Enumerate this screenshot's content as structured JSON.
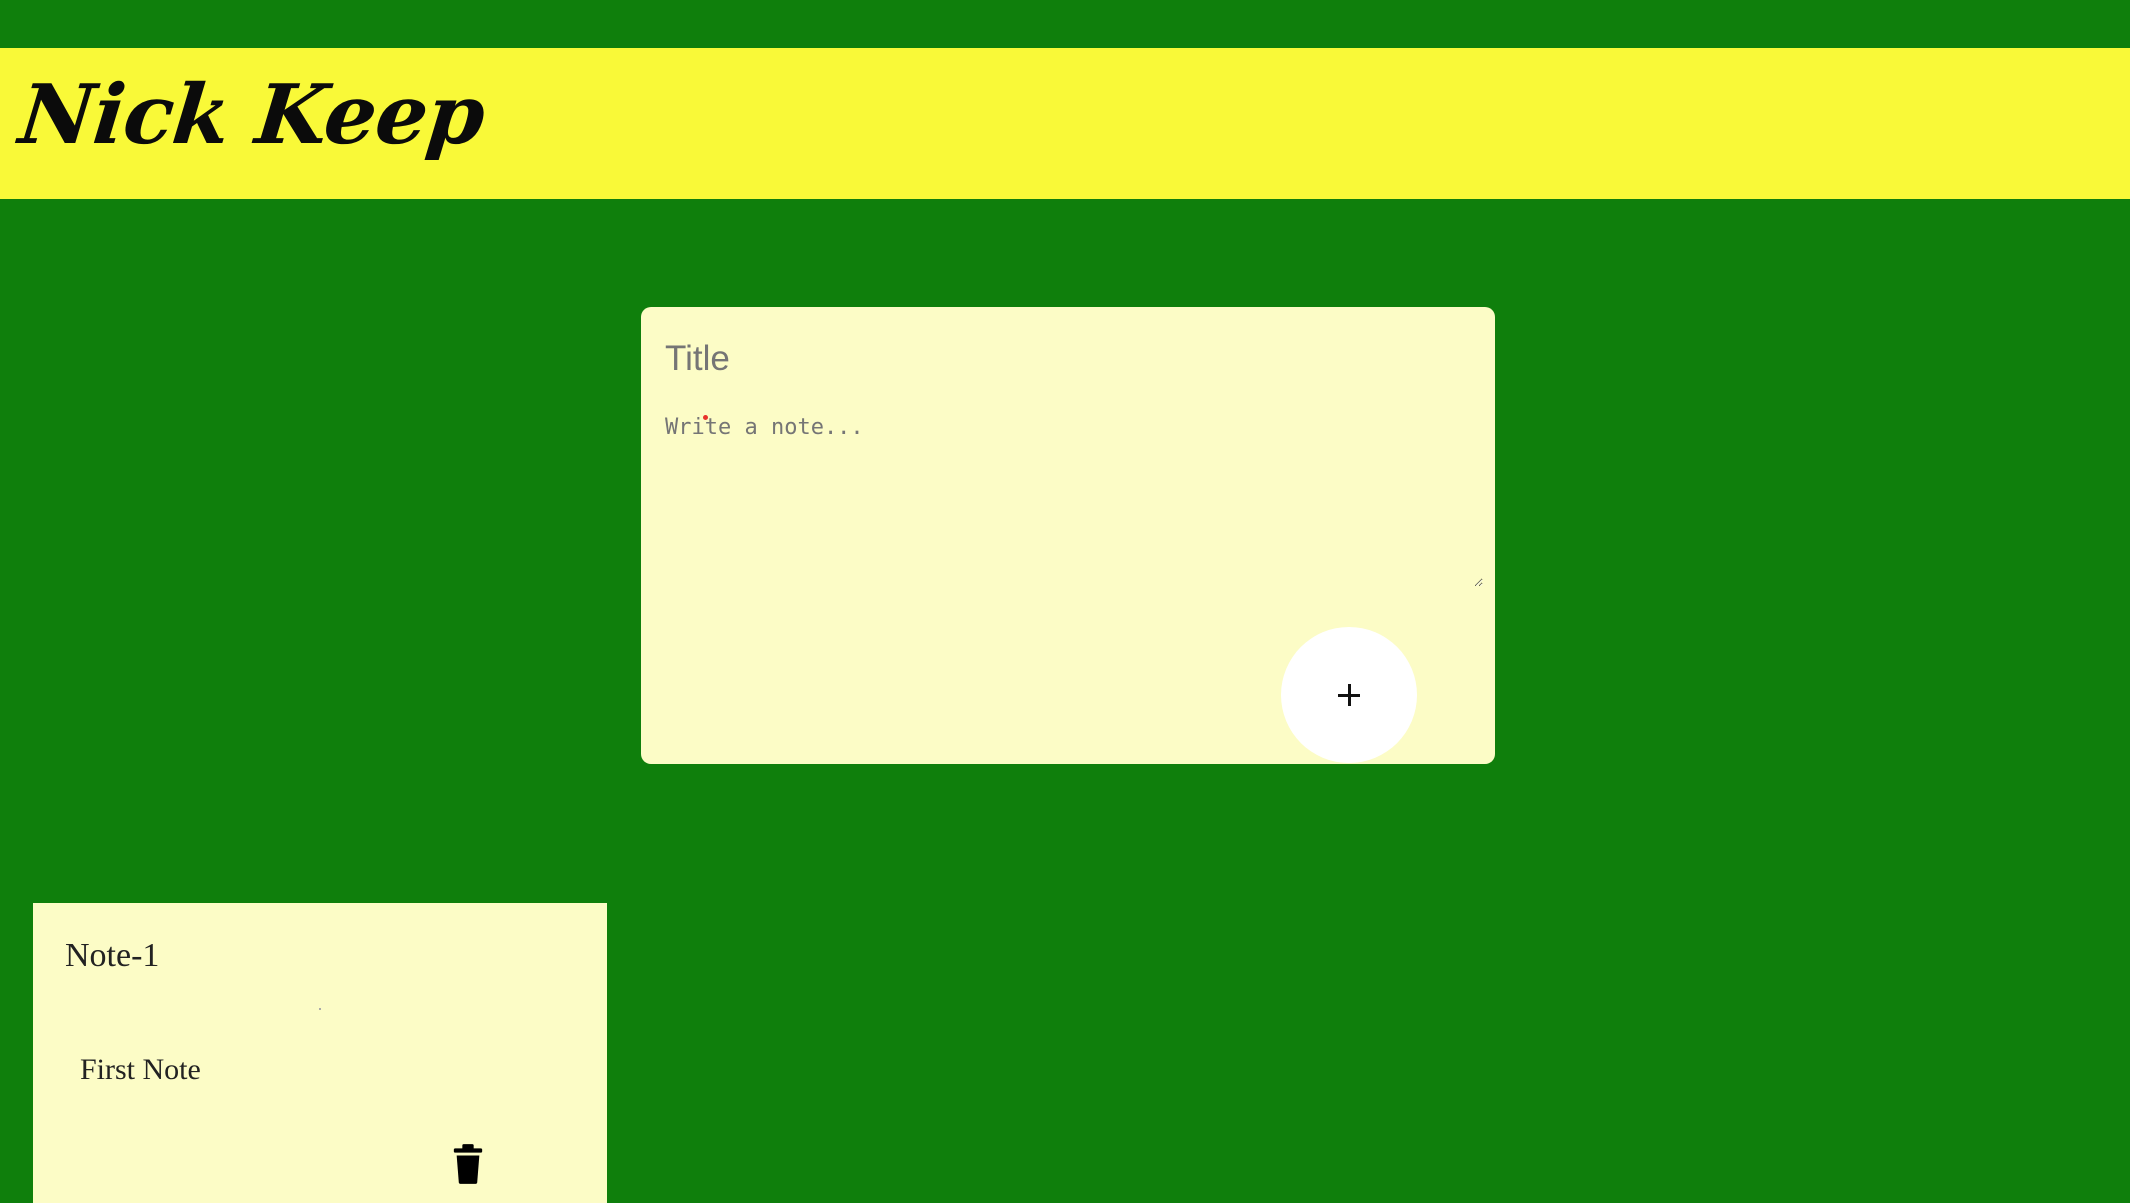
{
  "header": {
    "logo_text": "Nick Keep"
  },
  "composer": {
    "title_placeholder": "Title",
    "title_value": "",
    "note_placeholder": "Write a note...",
    "note_value": "",
    "add_button_icon": "plus-icon"
  },
  "notes": [
    {
      "title": "Note-1",
      "content": "First Note",
      "delete_icon": "trash-icon"
    }
  ],
  "colors": {
    "background": "#0f7f0c",
    "header": "#f9f938",
    "card": "#fcfcc6",
    "button": "#ffffff"
  }
}
